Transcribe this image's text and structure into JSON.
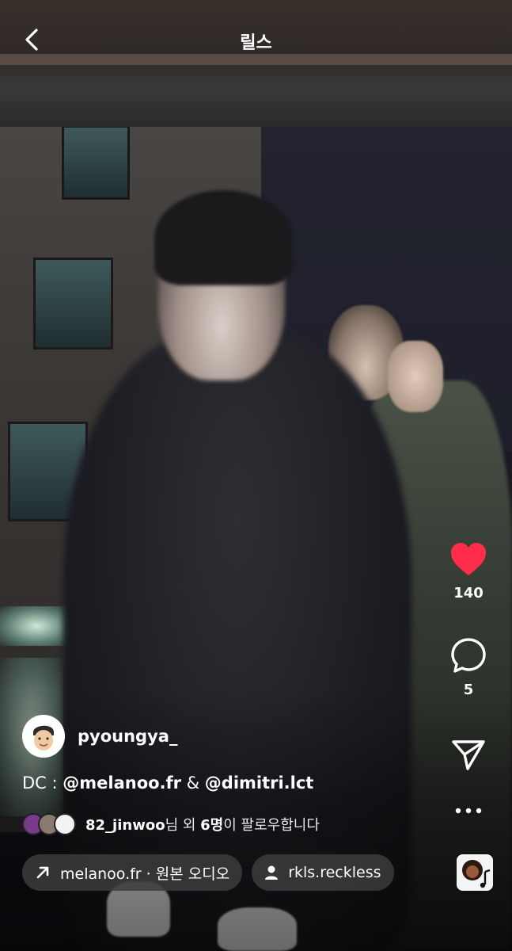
{
  "header": {
    "title": "릴스"
  },
  "actions": {
    "likes": "140",
    "comments": "5"
  },
  "post": {
    "username": "pyoungya_",
    "caption_prefix": "DC : ",
    "mention1": "@melanoo.fr",
    "separator": " & ",
    "mention2": "@dimitri.lct",
    "followers_user": "82_jinwoo",
    "followers_mid": "님 외 ",
    "followers_count": "6명",
    "followers_suffix": "이 팔로우합니다"
  },
  "chips": {
    "audio": "melanoo.fr · 원본 오디오",
    "tagged_user": "rkls.reckless"
  },
  "colors": {
    "like": "#ff2d4a"
  },
  "icons": [
    "back-chevron-icon",
    "heart-icon",
    "comment-icon",
    "send-icon",
    "more-icon",
    "arrow-up-right-icon",
    "person-icon",
    "audio-music-icon"
  ]
}
